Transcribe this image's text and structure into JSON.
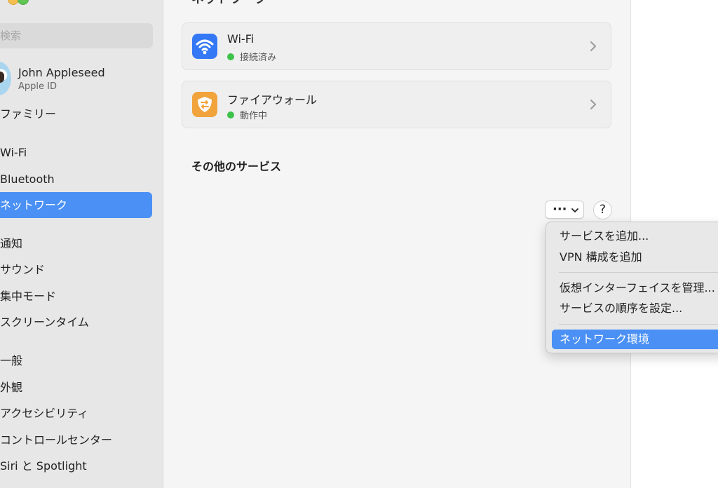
{
  "sidebar": {
    "search_placeholder": "検索",
    "account": {
      "name": "John Appleseed",
      "sub": "Apple ID"
    },
    "items": [
      {
        "label": "ファミリー"
      },
      {
        "label": "Wi-Fi"
      },
      {
        "label": "Bluetooth"
      },
      {
        "label": "ネットワーク",
        "selected": true
      },
      {
        "label": "通知"
      },
      {
        "label": "サウンド"
      },
      {
        "label": "集中モード"
      },
      {
        "label": "スクリーンタイム"
      },
      {
        "label": "一般"
      },
      {
        "label": "外観"
      },
      {
        "label": "アクセシビリティ"
      },
      {
        "label": "コントロールセンター"
      },
      {
        "label": "Siri と Spotlight"
      }
    ]
  },
  "main": {
    "title": "ネットワーク",
    "services": [
      {
        "title": "Wi-Fi",
        "status": "接続済み",
        "icon": "wifi-icon",
        "icon_color": "#3478f6",
        "status_color": "#3dc24a"
      },
      {
        "title": "ファイアウォール",
        "status": "動作中",
        "icon": "firewall-shield-icon",
        "icon_color": "#f1a33c",
        "status_color": "#3dc24a"
      }
    ],
    "other_services_title": "その他のサービス",
    "more_button": "···",
    "help_button": "?"
  },
  "menu": {
    "items": [
      {
        "label": "サービスを追加..."
      },
      {
        "label": "VPN 構成を追加"
      },
      {
        "label": "仮想インターフェイスを管理..."
      },
      {
        "label": "サービスの順序を設定..."
      },
      {
        "label": "ネットワーク環境",
        "highlighted": true
      }
    ]
  },
  "colors": {
    "accent": "#4a90f5",
    "sidebar_bg": "#e8e7e8",
    "main_bg": "#f5f5f5"
  }
}
